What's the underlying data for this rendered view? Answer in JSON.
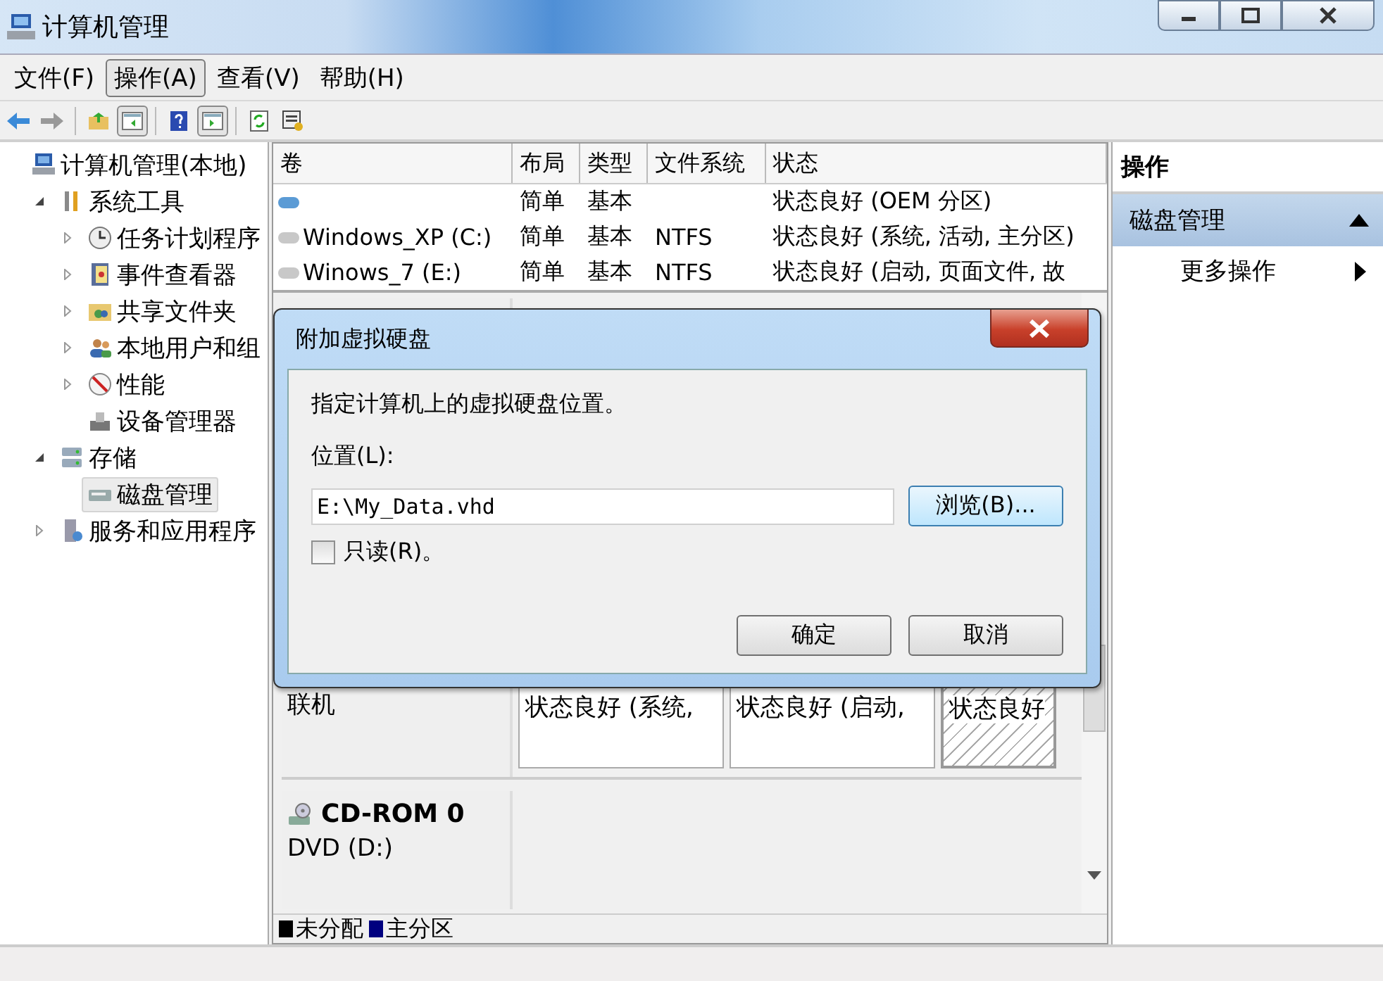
{
  "window": {
    "title": "计算机管理"
  },
  "menu": [
    {
      "label": "文件(F)",
      "selected": false
    },
    {
      "label": "操作(A)",
      "selected": true
    },
    {
      "label": "查看(V)",
      "selected": false
    },
    {
      "label": "帮助(H)",
      "selected": false
    }
  ],
  "toolbar_toggles": [
    {
      "pressed": true
    },
    {
      "pressed": true
    }
  ],
  "tree": [
    {
      "label": "计算机管理(本地)",
      "selected": false,
      "children": [
        {
          "label": "系统工具",
          "expanded": true,
          "selected": false,
          "children": [
            {
              "label": "任务计划程序",
              "expanded": false,
              "selected": false
            },
            {
              "label": "事件查看器",
              "expanded": false,
              "selected": false
            },
            {
              "label": "共享文件夹",
              "expanded": false,
              "selected": false
            },
            {
              "label": "本地用户和组",
              "expanded": false,
              "selected": false
            },
            {
              "label": "性能",
              "expanded": false,
              "selected": false
            },
            {
              "label": "设备管理器",
              "selected": false
            }
          ]
        },
        {
          "label": "存储",
          "expanded": true,
          "selected": false,
          "children": [
            {
              "label": "磁盘管理",
              "selected": true
            }
          ]
        },
        {
          "label": "服务和应用程序",
          "expanded": false,
          "selected": false
        }
      ]
    }
  ],
  "volume_table": {
    "columns": [
      "卷",
      "布局",
      "类型",
      "文件系统",
      "状态"
    ],
    "rows": [
      {
        "color": "#5b9bd5",
        "layout": "简单",
        "type": "基本",
        "status": "状态良好 (OEM 分区)"
      },
      {
        "color": "#c8c8c8",
        "volume": "Windows_XP (C:)",
        "layout": "简单",
        "type": "基本",
        "file_system": "NTFS",
        "status": "状态良好 (系统, 活动, 主分区)"
      },
      {
        "color": "#c8c8c8",
        "volume": "Winows_7 (E:)",
        "layout": "简单",
        "type": "基本",
        "file_system": "NTFS",
        "status": "状态良好 (启动, 页面文件, 故"
      }
    ]
  },
  "disk_view": {
    "disks": [
      {
        "state": "联机",
        "partitions": [
          {
            "status": "状态良好 (系统,",
            "selected": false
          },
          {
            "status": "状态良好 (启动,",
            "selected": false
          },
          {
            "status": "状态良好",
            "selected": true
          }
        ]
      },
      {
        "name": "CD-ROM 0",
        "type": "DVD (D:)"
      }
    ],
    "legend": [
      {
        "label": "未分配",
        "color": "#000000"
      },
      {
        "label": "主分区",
        "color": "#00007f"
      }
    ]
  },
  "actions": {
    "title": "操作",
    "section": {
      "label": "磁盘管理",
      "expanded": true
    },
    "items": [
      "更多操作"
    ]
  },
  "dialog": {
    "title": "附加虚拟硬盘",
    "prompt": "指定计算机上的虚拟硬盘位置。",
    "location_label": "位置(L):",
    "location_value": "E:\\My_Data.vhd",
    "browse": {
      "label": "浏览(B)...",
      "focused": true
    },
    "read_only": {
      "label": "只读(R)。",
      "checked": false
    },
    "buttons": [
      {
        "label": "确定",
        "focused": false
      },
      {
        "label": "取消",
        "focused": false
      }
    ]
  }
}
